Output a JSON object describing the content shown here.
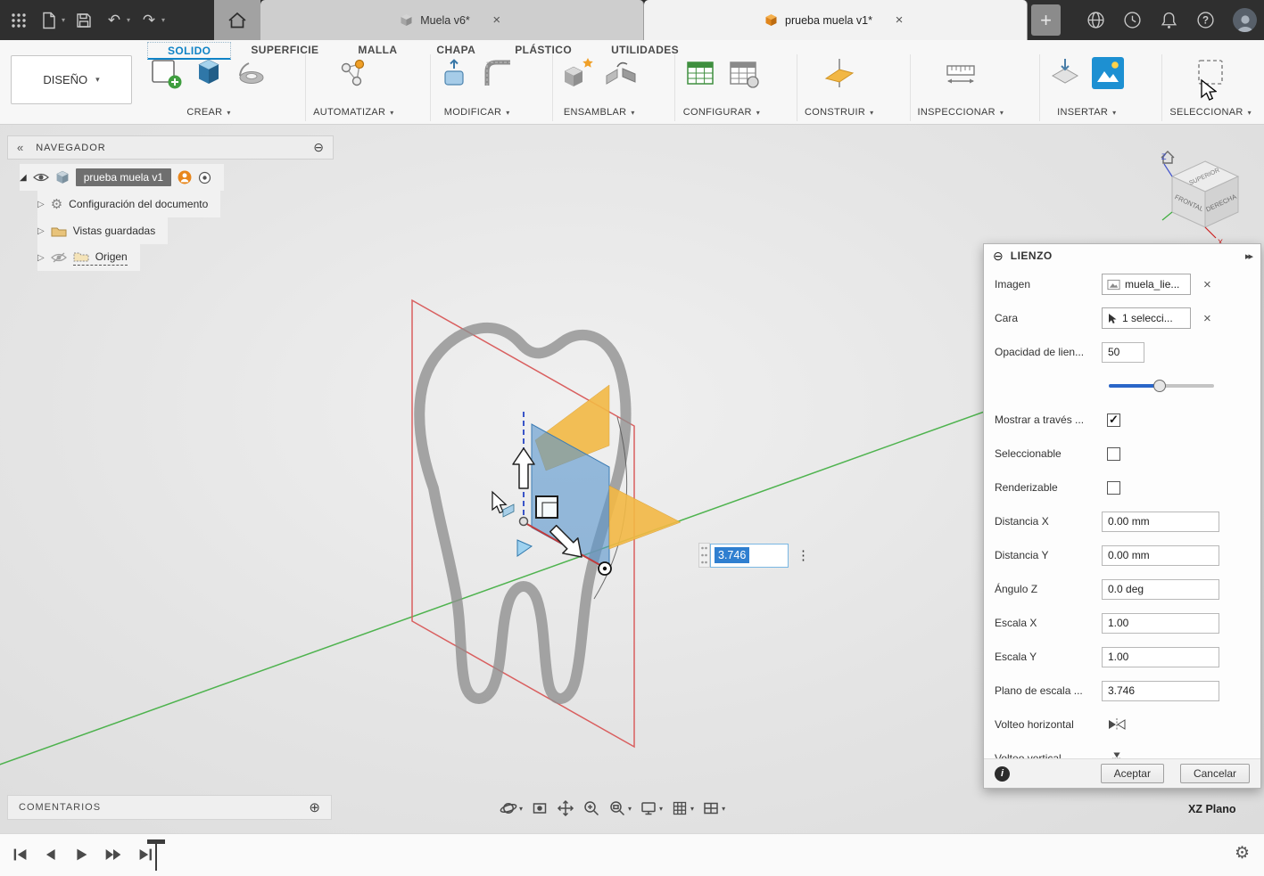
{
  "topbar": {
    "tabs": [
      {
        "label": "Muela v6*"
      },
      {
        "label": "prueba muela v1*"
      }
    ]
  },
  "ribbon": {
    "tabs": [
      {
        "label": "SOLIDO"
      },
      {
        "label": "SUPERFICIE"
      },
      {
        "label": "MALLA"
      },
      {
        "label": "CHAPA"
      },
      {
        "label": "PLÁSTICO"
      },
      {
        "label": "UTILIDADES"
      }
    ],
    "design_button": "DISEÑO",
    "groups": [
      {
        "label": "CREAR"
      },
      {
        "label": "AUTOMATIZAR"
      },
      {
        "label": "MODIFICAR"
      },
      {
        "label": "ENSAMBLAR"
      },
      {
        "label": "CONFIGURAR"
      },
      {
        "label": "CONSTRUIR"
      },
      {
        "label": "INSPECCIONAR"
      },
      {
        "label": "INSERTAR"
      },
      {
        "label": "SELECCIONAR"
      }
    ]
  },
  "navigator": {
    "title": "NAVEGADOR",
    "root_label": "prueba muela v1",
    "items": [
      {
        "label": "Configuración del documento"
      },
      {
        "label": "Vistas guardadas"
      },
      {
        "label": "Origen"
      }
    ]
  },
  "lienzo": {
    "title": "LIENZO",
    "fields": {
      "imagen_label": "Imagen",
      "imagen_value": "muela_lie...",
      "cara_label": "Cara",
      "cara_value": "1 selecci...",
      "opacidad_label": "Opacidad de lien...",
      "opacidad_value": "50",
      "mostrar_label": "Mostrar a través ...",
      "seleccionable_label": "Seleccionable",
      "renderizable_label": "Renderizable",
      "dx_label": "Distancia X",
      "dx_value": "0.00 mm",
      "dy_label": "Distancia Y",
      "dy_value": "0.00 mm",
      "az_label": "Ángulo Z",
      "az_value": "0.0 deg",
      "ex_label": "Escala X",
      "ex_value": "1.00",
      "ey_label": "Escala Y",
      "ey_value": "1.00",
      "plano_label": "Plano de escala ...",
      "plano_value": "3.746",
      "vh_label": "Volteo horizontal",
      "vv_label": "Volteo vertical"
    },
    "accept": "Aceptar",
    "cancel": "Cancelar"
  },
  "canvas": {
    "dimension_value": "3.746",
    "plane_indicator": "XZ Plano"
  },
  "viewcube": {
    "top": "SUPERIOR",
    "front": "FRONTAL",
    "right": "DERECHA",
    "x": "X",
    "z": "Z"
  },
  "comments": {
    "title": "COMENTARIOS"
  },
  "colors": {
    "accent": "#0696d7",
    "plane_orange": "#f2b33d",
    "selection_blue": "#2f7fd0",
    "highlight_red": "#d95f5f"
  }
}
